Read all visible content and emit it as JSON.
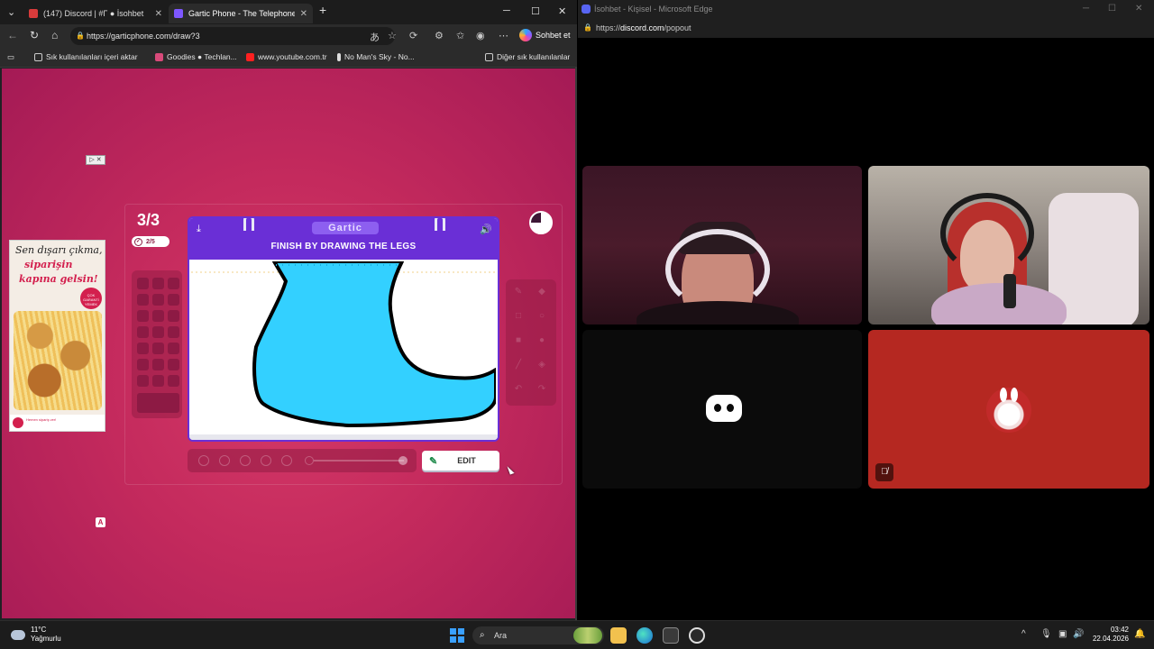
{
  "left_browser": {
    "tabs": [
      {
        "title": "(147) Discord | #Γ ● İsohbet",
        "active": false,
        "color": "#d83b3b"
      },
      {
        "title": "Gartic Phone - The Telephone Gar",
        "active": true,
        "color": "#7e57ff"
      }
    ],
    "new_tab": "+",
    "url": "https://garticphone.com/draw?3",
    "sohbet_label": "Sohbet et",
    "bookmarks": [
      {
        "label": "Sık kullanılanları içeri aktar",
        "icon": "folder-icon"
      },
      {
        "label": "Goodies ● Techlan...",
        "icon": "bookmark-icon"
      },
      {
        "label": "www.youtube.com.tr",
        "icon": "youtube-icon"
      },
      {
        "label": "No Man's Sky - No...",
        "icon": "bookmark-icon"
      }
    ],
    "other_bookmarks": "Diğer sık kullanılanlar"
  },
  "ad": {
    "line1": "Sen dışarı çıkma,",
    "line2": "siparişin",
    "line3": "kapına gelsin!",
    "badge": "ÇOK GARANTİ YEMEK",
    "footer": "Hemen sipariş ver!",
    "tag": "A"
  },
  "game": {
    "round": "3/3",
    "progress": "2/5",
    "logo": "Gartic",
    "prompt": "FINISH BY DRAWING THE LEGS",
    "edit_label": "EDIT",
    "accent": "#6a2fd6",
    "drawing_fill": "#33d0ff",
    "timer_fraction_elapsed": 0.75
  },
  "right_window": {
    "title": "İsohbet - Kişisel - Microsoft Edge",
    "url_prefix": "https://",
    "url_host": "discord.com",
    "url_path": "/popout",
    "mute_icon": "mic-off-icon"
  },
  "taskbar": {
    "temp": "11°C",
    "condition": "Yağmurlu",
    "search": "Ara",
    "time": "03:42",
    "date": "22.04.2026"
  }
}
